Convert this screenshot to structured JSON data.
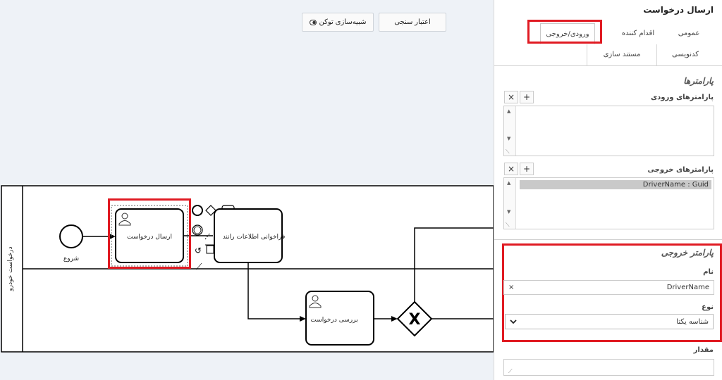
{
  "toolbar": {
    "validate_label": "اعتبار سنجی",
    "token_label": "شبیه‌سازی توکن"
  },
  "diagram": {
    "lane_label": "درخواست خودرو",
    "start_label": "شروع",
    "task_send": "ارسال درخواست",
    "task_read": "فراخوانی اطلاعات رانند",
    "task_review": "بررسی درخواست",
    "gateway_symbol": "X"
  },
  "panel": {
    "title": "ارسال درخواست",
    "tabs": {
      "general": "عمومی",
      "initiator": "اقدام کننده",
      "io": "ورودی/خروجی",
      "kandovisi": "کدنویسی",
      "docs": "مستند سازی"
    },
    "params_section": "پارامترها",
    "input_params_label": "پارامترهای ورودی",
    "output_params_label": "پارامترهای خروجی",
    "add_symbol": "+",
    "remove_symbol": "×",
    "output_params": [
      "DriverName : Guid"
    ],
    "output_param_section": "پارامتر خروجی",
    "name_label": "نام",
    "name_value": "DriverName",
    "clear_symbol": "×",
    "type_label": "نوع",
    "type_value": "شناسه یکتا",
    "value_label": "مقدار"
  },
  "icons": {
    "chevron": "chevron-down-icon",
    "user": "user-icon",
    "token": "toggle-icon"
  },
  "colors": {
    "highlight": "#e01a22",
    "canvas": "#eef2f7"
  }
}
